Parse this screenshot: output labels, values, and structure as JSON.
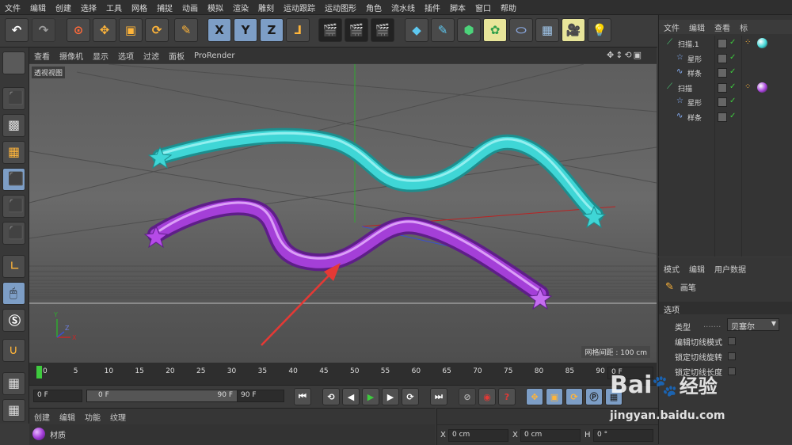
{
  "menubar": [
    "文件",
    "编辑",
    "创建",
    "选择",
    "工具",
    "网格",
    "捕捉",
    "动画",
    "模拟",
    "渲染",
    "雕刻",
    "运动跟踪",
    "运动图形",
    "角色",
    "流水线",
    "插件",
    "脚本",
    "窗口",
    "帮助"
  ],
  "toolbar": {
    "xyz": [
      "X",
      "Y",
      "Z"
    ]
  },
  "viewport": {
    "menu": [
      "查看",
      "摄像机",
      "显示",
      "选项",
      "过滤",
      "面板",
      "ProRender"
    ],
    "label": "透视视图",
    "grid_info": "网格间距 : 100 cm"
  },
  "timeline": {
    "ticks": [
      "0",
      "5",
      "10",
      "15",
      "20",
      "25",
      "30",
      "35",
      "40",
      "45",
      "50",
      "55",
      "60",
      "65",
      "70",
      "75",
      "80",
      "85",
      "90"
    ],
    "current_frame": "0 F"
  },
  "playback": {
    "start": "0 F",
    "range_start": "0 F",
    "range_end": "90 F",
    "end": "90 F"
  },
  "material_panel": {
    "menu": [
      "创建",
      "编辑",
      "功能",
      "纹理"
    ],
    "material_name": "材质"
  },
  "coords": {
    "x_label": "X",
    "x_value": "0 cm",
    "x2_label": "X",
    "x2_value": "0 cm",
    "h_label": "H",
    "h_value": "0 °"
  },
  "object_manager": {
    "menu": [
      "文件",
      "编辑",
      "查看",
      "标"
    ],
    "objects": [
      {
        "name": "扫描.1",
        "indent": 0,
        "icon": "sweep-icon"
      },
      {
        "name": "星形",
        "indent": 1,
        "icon": "star-spline-icon"
      },
      {
        "name": "样条",
        "indent": 1,
        "icon": "spline-icon"
      },
      {
        "name": "扫描",
        "indent": 0,
        "icon": "sweep-icon"
      },
      {
        "name": "星形",
        "indent": 1,
        "icon": "star-spline-icon"
      },
      {
        "name": "样条",
        "indent": 1,
        "icon": "spline-icon"
      }
    ]
  },
  "attributes": {
    "menu": [
      "模式",
      "编辑",
      "用户数据"
    ],
    "tool_name": "画笔",
    "section": "选项",
    "type_label": "类型",
    "type_value": "贝塞尔",
    "options": [
      "编辑切线模式",
      "锁定切线旋转",
      "锁定切线长度"
    ]
  },
  "watermark": {
    "brand": "Bai",
    "brand2": "经验",
    "url": "jingyan.baidu.com"
  },
  "colors": {
    "cyan_tube": "#3fd6d6",
    "purple_tube": "#a43fd8",
    "accent_blue": "#7d9ec6",
    "annotation_arrow": "#e53935"
  }
}
